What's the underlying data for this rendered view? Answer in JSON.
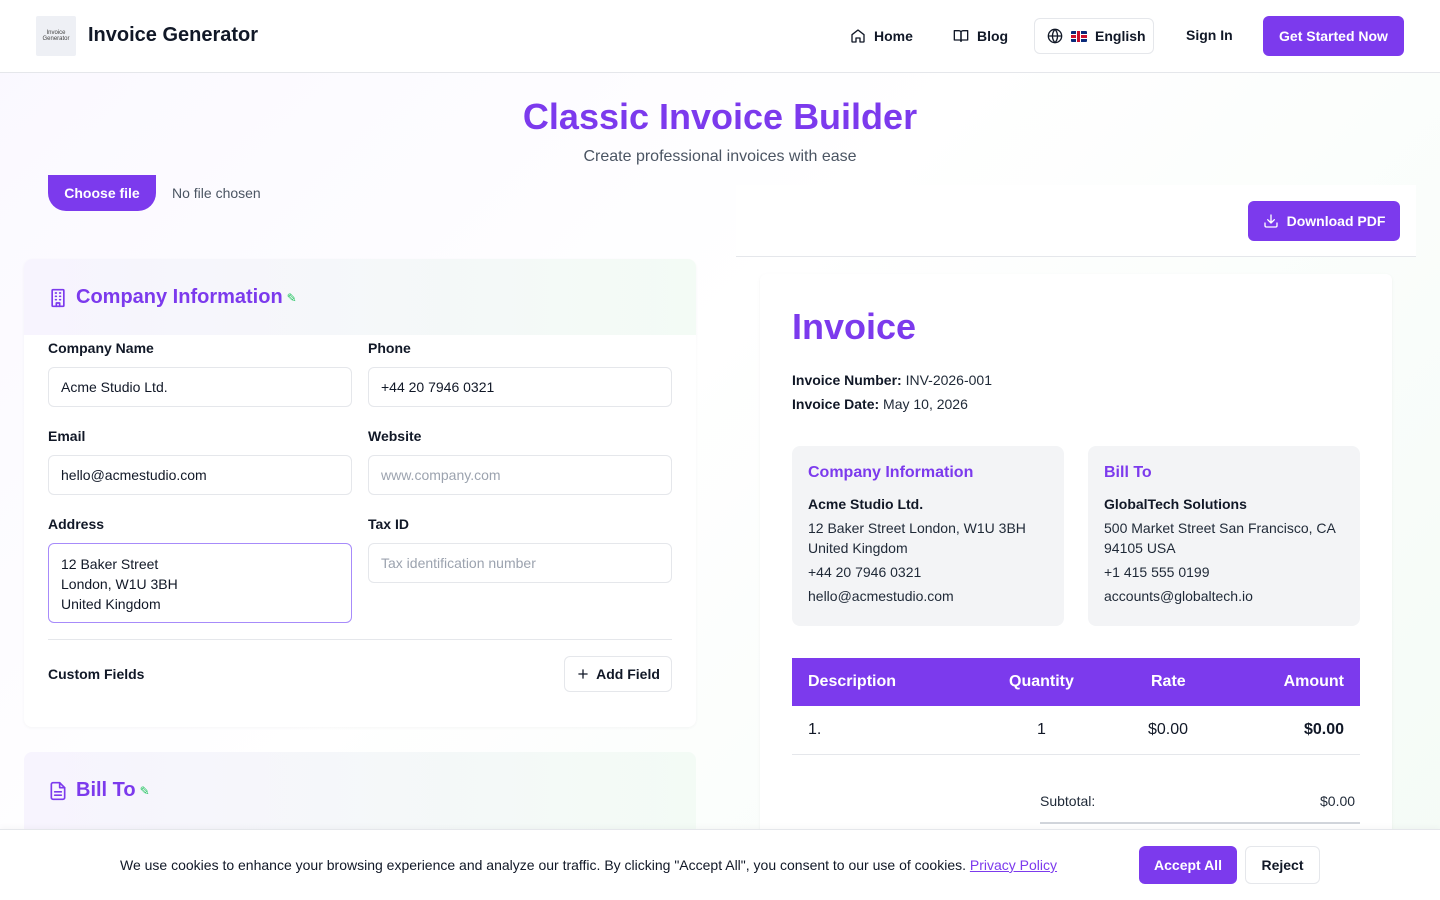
{
  "nav": {
    "logo_text": "Invoice Generator",
    "brand": "Invoice Generator",
    "home": "Home",
    "blog": "Blog",
    "language": "English",
    "signin": "Sign In",
    "cta": "Get Started Now"
  },
  "header": {
    "title": "Classic Invoice Builder",
    "subtitle": "Create professional invoices with ease"
  },
  "file": {
    "button": "Choose file",
    "status": "No file chosen"
  },
  "company_form": {
    "title": "Company Information",
    "company_name_label": "Company Name",
    "company_name_value": "Acme Studio Ltd.",
    "phone_label": "Phone",
    "phone_value": "+44 20 7946 0321",
    "email_label": "Email",
    "email_value": "hello@acmestudio.com",
    "website_label": "Website",
    "website_placeholder": "www.company.com",
    "address_label": "Address",
    "address_value": "12 Baker Street\nLondon, W1U 3BH\nUnited Kingdom",
    "taxid_label": "Tax ID",
    "taxid_placeholder": "Tax identification number",
    "custom_fields_label": "Custom Fields",
    "add_field_button": "Add Field"
  },
  "bill_to_form": {
    "title": "Bill To"
  },
  "preview": {
    "download_button": "Download PDF",
    "title": "Invoice",
    "invoice_number_label": "Invoice Number:",
    "invoice_number": "INV-2026-001",
    "invoice_date_label": "Invoice Date:",
    "invoice_date": "May 10, 2026",
    "company": {
      "title": "Company Information",
      "name": "Acme Studio Ltd.",
      "address": "12 Baker Street London, W1U 3BH United Kingdom",
      "phone": "+44 20 7946 0321",
      "email": "hello@acmestudio.com"
    },
    "bill_to": {
      "title": "Bill To",
      "name": "GlobalTech Solutions",
      "address": "500 Market Street San Francisco, CA 94105 USA",
      "phone": "+1 415 555 0199",
      "email": "accounts@globaltech.io"
    },
    "table": {
      "headers": [
        "Description",
        "Quantity",
        "Rate",
        "Amount"
      ],
      "rows": [
        {
          "description": "1.",
          "quantity": "1",
          "rate": "$0.00",
          "amount": "$0.00"
        }
      ]
    },
    "subtotal_label": "Subtotal:",
    "subtotal_value": "$0.00"
  },
  "cookie": {
    "text": "We use cookies to enhance your browsing experience and analyze our traffic. By clicking \"Accept All\", you consent to our use of cookies.",
    "link": "Privacy Policy",
    "accept": "Accept All",
    "reject": "Reject"
  },
  "colors": {
    "accent": "#7c3aed",
    "pencil": "#22c55e"
  }
}
